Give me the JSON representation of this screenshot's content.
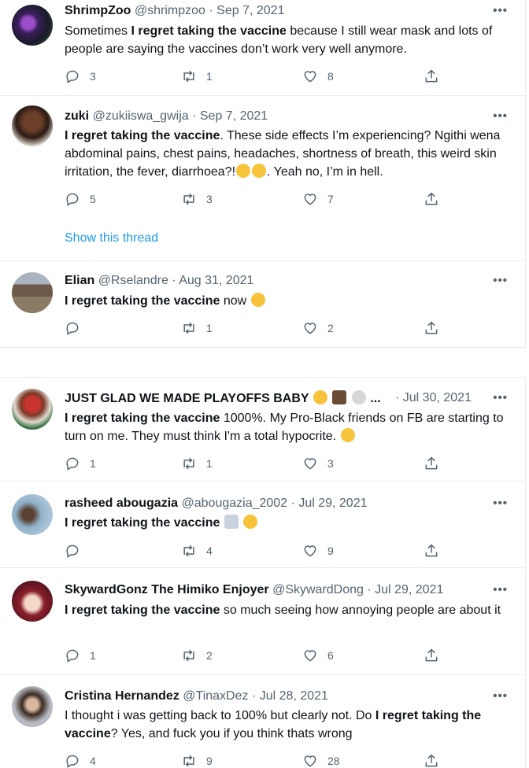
{
  "tweets": [
    {
      "name": "ShrimpZoo",
      "handle": "@shrimpzoo",
      "sep": "·",
      "date": "Sep 7, 2021",
      "text_pre": "Sometimes ",
      "text_bold": "I regret taking the vaccine",
      "text_post": " because I still wear mask and lots of  people are saying the vaccines don’t work very well anymore.",
      "replies": "3",
      "retweets": "1",
      "likes": "8"
    },
    {
      "name": "zuki",
      "handle": "@zukiiswa_gwija",
      "sep": "·",
      "date": "Sep 7, 2021",
      "text_pre": "",
      "text_bold": "I regret taking the vaccine",
      "text_post": ". These side effects I’m experiencing? Ngithi wena abdominal pains, chest pains, headaches, shortness of breath, this weird skin irritation, the fever, diarrhoea?!",
      "text_after_emoji": ". Yeah no, I’m in hell.",
      "replies": "5",
      "retweets": "3",
      "likes": "7",
      "thread_link": "Show this thread"
    },
    {
      "name": "Elian",
      "handle": "@Rselandre",
      "sep": "·",
      "date": "Aug 31, 2021",
      "text_pre": "",
      "text_bold": "I regret taking the vaccine",
      "text_post": " now",
      "replies": "",
      "retweets": "1",
      "likes": "2"
    },
    {
      "name": "JUST GLAD WE MADE PLAYOFFS BABY",
      "name_suffix": " ...",
      "handle": "",
      "sep": "·",
      "date": "Jul 30, 2021",
      "text_pre": "",
      "text_bold": "I regret taking the vaccine",
      "text_post": " 1000%. My Pro-Black friends on FB are starting to turn on me. They must think I'm a total hypocrite.",
      "replies": "1",
      "retweets": "1",
      "likes": "3"
    },
    {
      "name": "rasheed abougazia",
      "handle": "@abougazia_2002",
      "sep": "·",
      "date": "Jul 29, 2021",
      "text_pre": "",
      "text_bold": "I regret taking the vaccine",
      "text_post": "",
      "replies": "",
      "retweets": "4",
      "likes": "9"
    },
    {
      "name": "SkywardGonz The Himiko Enjoyer",
      "handle": "@SkywardDong",
      "sep": "·",
      "date": "Jul 29, 2021",
      "text_pre": "",
      "text_bold": "I regret taking the vaccine",
      "text_post": " so much seeing how annoying people are about it",
      "replies": "1",
      "retweets": "2",
      "likes": "6"
    },
    {
      "name": "Cristina Hernandez",
      "handle": "@TinaxDez",
      "sep": "·",
      "date": "Jul 28, 2021",
      "text_pre": "I thought i was getting back to 100% but clearly not. Do ",
      "text_bold": "I regret taking the vaccine",
      "text_post": "? Yes, and fuck you if you think thats wrong",
      "replies": "4",
      "retweets": "9",
      "likes": "28"
    }
  ],
  "more_label": "•••",
  "colors": {
    "link": "#1d9bf0",
    "secondary": "#536471",
    "border": "#e6ecf0"
  }
}
